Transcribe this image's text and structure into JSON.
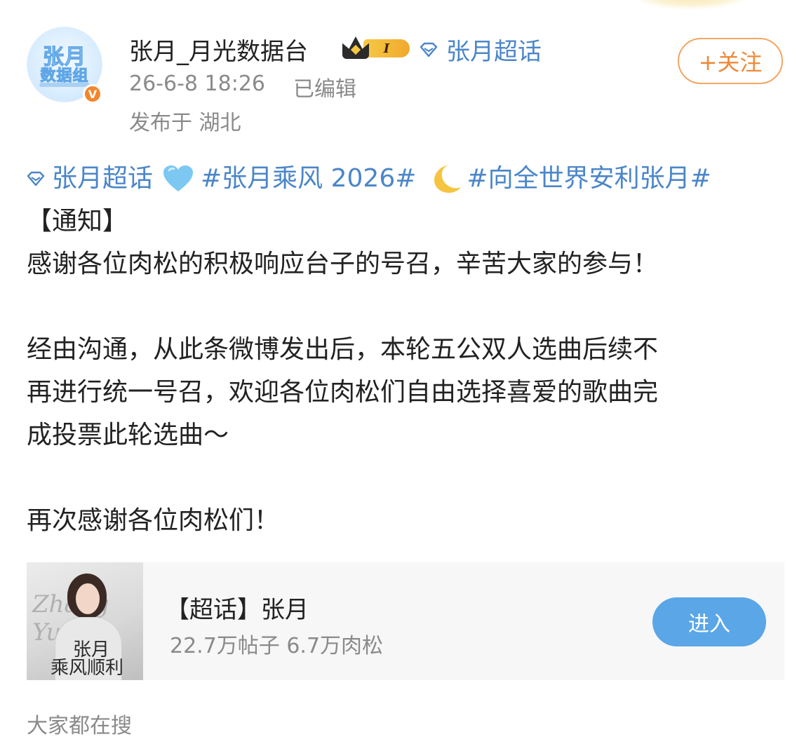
{
  "header": {
    "user_name": "张月_月光数据台",
    "level_badge": "I",
    "super_topic_link": "张月超话",
    "timestamp": "26-6-8 18:26",
    "edited_label": "已编辑",
    "location": "发布于 湖北",
    "follow_button": "+关注",
    "avatar_text_line1": "张月",
    "avatar_text_line2": "数据组",
    "verified_mark": "V"
  },
  "post": {
    "topic_link": "张月超话",
    "hashtag_1": "#张月乘风 2026#",
    "hashtag_2": "#向全世界安利张月#",
    "notice_title": "【通知】",
    "paragraph_1": "感谢各位肉松的积极响应台子的号召，辛苦大家的参与！",
    "paragraph_2_lines": [
      "经由沟通，从此条微博发出后，本轮五公双人选曲后续不",
      "再进行统一号召，欢迎各位肉松们自由选择喜爱的歌曲完",
      "成投票此轮选曲～"
    ],
    "paragraph_3": "再次感谢各位肉松们！"
  },
  "card": {
    "title": "【超话】张月",
    "stats": "22.7万帖子 6.7万肉松",
    "enter_button": "进入",
    "thumb_script": "Zhang Yue",
    "thumb_text_1": "张月",
    "thumb_text_2": "乘风顺利"
  },
  "footer": {
    "search_label": "大家都在搜"
  },
  "colors": {
    "link_blue": "#4b86c9",
    "follow_orange": "#ef8a3a",
    "enter_blue": "#5aa6e7",
    "verified_orange": "#f3862d"
  },
  "icons": [
    "diamond-icon",
    "blue-heart-icon",
    "crescent-moon-icon",
    "crown-icon",
    "verified-icon"
  ]
}
